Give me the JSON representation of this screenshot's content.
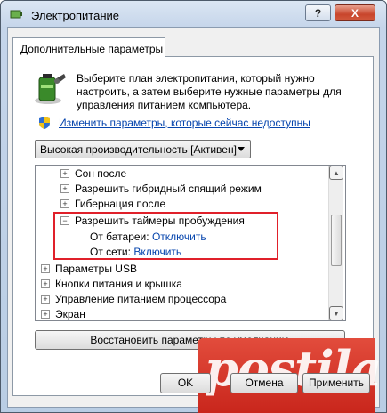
{
  "window": {
    "title": "Электропитание",
    "help_label": "?",
    "close_label": "X"
  },
  "tab": {
    "label": "Дополнительные параметры"
  },
  "intro_text": "Выберите план электропитания, который нужно настроить, а затем выберите нужные параметры для управления питанием компьютера.",
  "change_link": "Изменить параметры, которые сейчас недоступны",
  "plan_select": {
    "value": "Высокая производительность [Активен]"
  },
  "tree": {
    "items": [
      {
        "label": "Сон после",
        "expander": "+"
      },
      {
        "label": "Разрешить гибридный спящий режим",
        "expander": "+"
      },
      {
        "label": "Гибернация после",
        "expander": "+"
      },
      {
        "label": "Разрешить таймеры пробуждения",
        "expander": "−"
      },
      {
        "label": "От батареи:",
        "value": "Отключить"
      },
      {
        "label": "От сети:",
        "value": "Включить"
      },
      {
        "label": "Параметры USB",
        "expander": "+"
      },
      {
        "label": "Кнопки питания и крышка",
        "expander": "+"
      },
      {
        "label": "Управление питанием процессора",
        "expander": "+"
      },
      {
        "label": "Экран",
        "expander": "+"
      }
    ]
  },
  "buttons": {
    "restore": "Восстановить параметры по умолчанию",
    "ok": "OK",
    "cancel": "Отмена",
    "apply": "Применить"
  },
  "watermark": {
    "text": "Postila"
  },
  "colors": {
    "highlight": "#e0202a",
    "link": "#0645ad",
    "watermark": "#d2362a"
  }
}
